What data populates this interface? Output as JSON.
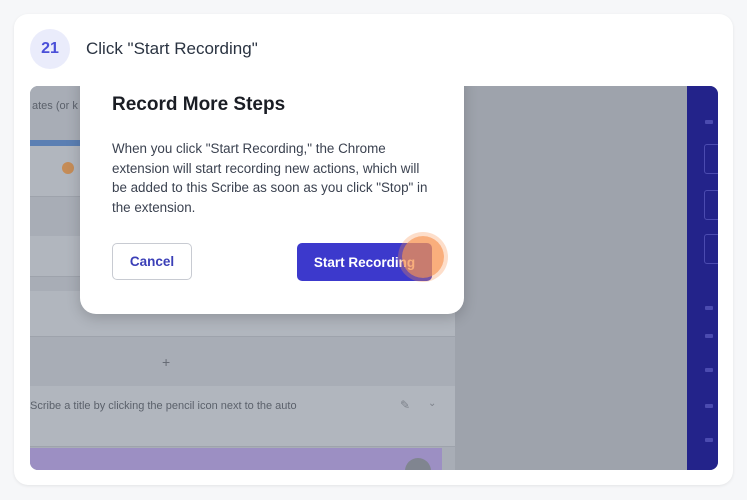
{
  "step": {
    "number": "21",
    "title": "Click \"Start Recording\""
  },
  "modal": {
    "title": "Record More Steps",
    "body": "When you click \"Start Recording,\" the Chrome extension will start recording new actions, which will be added to this Scribe as soon as you click \"Stop\" in the extension.",
    "cancel_label": "Cancel",
    "start_label": "Start Recording"
  },
  "background": {
    "header_fragment": "ates (or k",
    "hint_text": "Scribe a title by clicking the pencil icon next to the auto",
    "plus_glyph": "+"
  },
  "colors": {
    "accent": "#3c39cc",
    "badge_bg": "#eaecfb",
    "click_marker": "#f79350"
  },
  "icons": {
    "click_marker": "click-highlight-icon",
    "pencil": "pencil-icon",
    "chevron": "chevron-down-icon"
  }
}
